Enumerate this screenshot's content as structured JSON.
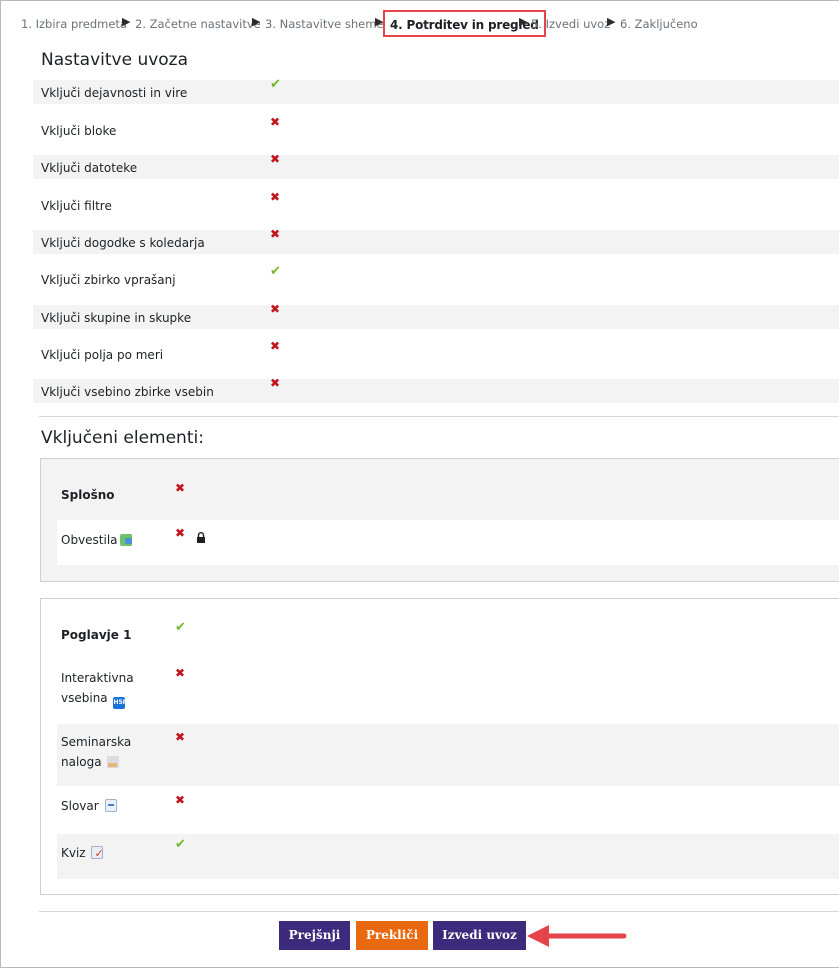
{
  "breadcrumb": {
    "steps": [
      "1. Izbira predmeta",
      "2. Začetne nastavitve",
      "3. Nastavitve sheme",
      "4. Potrditev in pregled",
      "5. Izvedi uvoz",
      "6. Zaključeno"
    ],
    "separator": "▶"
  },
  "settings": {
    "heading": "Nastavitve uvoza",
    "items": [
      {
        "label": "Vključi dejavnosti in vire",
        "enabled": true
      },
      {
        "label": "Vključi bloke",
        "enabled": false
      },
      {
        "label": "Vključi datoteke",
        "enabled": false
      },
      {
        "label": "Vključi filtre",
        "enabled": false
      },
      {
        "label": "Vključi dogodke s koledarja",
        "enabled": false
      },
      {
        "label": "Vključi zbirko vprašanj",
        "enabled": true
      },
      {
        "label": "Vključi skupine in skupke",
        "enabled": false
      },
      {
        "label": "Vključi polja po meri",
        "enabled": false
      },
      {
        "label": "Vključi vsebino zbirke vsebin",
        "enabled": false
      }
    ]
  },
  "elements": {
    "heading": "Vključeni elementi:",
    "sections": [
      {
        "title": "Splošno",
        "enabled": false,
        "items": [
          {
            "label": "Obvestila",
            "icon": "forum-icon",
            "enabled": false,
            "locked": true
          }
        ]
      },
      {
        "title": "Poglavje 1",
        "enabled": true,
        "items": [
          {
            "label_line1": "Interaktivna",
            "label_line2": "vsebina",
            "icon": "h5p-icon",
            "icon_text": "H5P",
            "enabled": false
          },
          {
            "label_line1": "Seminarska",
            "label_line2": "naloga",
            "icon": "assignment-icon",
            "enabled": false
          },
          {
            "label": "Slovar",
            "icon": "glossary-icon",
            "enabled": false
          },
          {
            "label": "Kviz",
            "icon": "quiz-icon",
            "enabled": true
          }
        ]
      }
    ]
  },
  "buttons": {
    "previous": "Prejšnji",
    "cancel": "Prekliči",
    "perform_import": "Izvedi uvoz"
  },
  "colors": {
    "primary_button": "#3c2a7c",
    "cancel_button": "#e8690f",
    "check": "#76b32c",
    "cross": "#c4131e",
    "highlight": "#e4454a"
  }
}
